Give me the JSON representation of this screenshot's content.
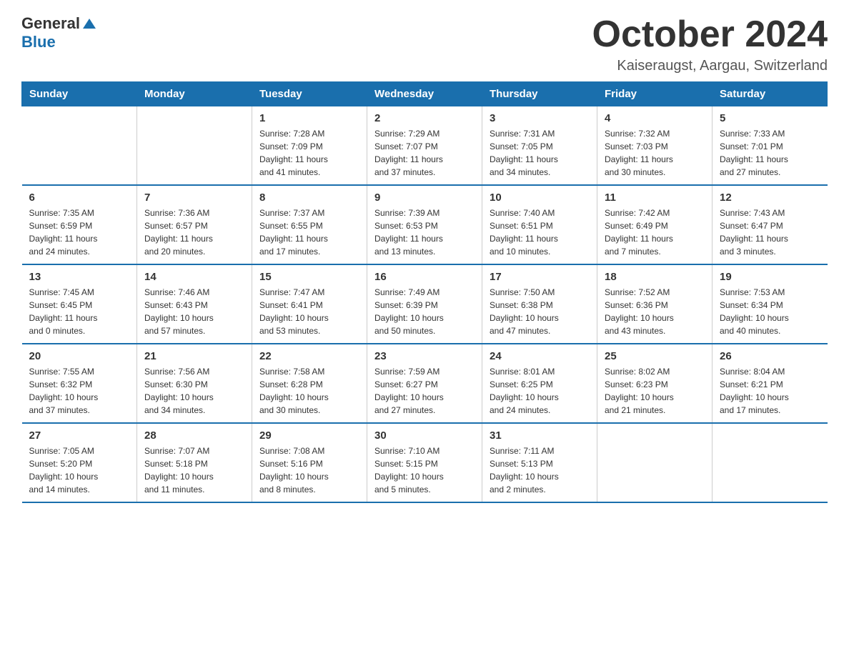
{
  "header": {
    "logo_general": "General",
    "logo_blue": "Blue",
    "title": "October 2024",
    "location": "Kaiseraugst, Aargau, Switzerland"
  },
  "columns": [
    "Sunday",
    "Monday",
    "Tuesday",
    "Wednesday",
    "Thursday",
    "Friday",
    "Saturday"
  ],
  "weeks": [
    [
      {
        "day": "",
        "info": ""
      },
      {
        "day": "",
        "info": ""
      },
      {
        "day": "1",
        "info": "Sunrise: 7:28 AM\nSunset: 7:09 PM\nDaylight: 11 hours\nand 41 minutes."
      },
      {
        "day": "2",
        "info": "Sunrise: 7:29 AM\nSunset: 7:07 PM\nDaylight: 11 hours\nand 37 minutes."
      },
      {
        "day": "3",
        "info": "Sunrise: 7:31 AM\nSunset: 7:05 PM\nDaylight: 11 hours\nand 34 minutes."
      },
      {
        "day": "4",
        "info": "Sunrise: 7:32 AM\nSunset: 7:03 PM\nDaylight: 11 hours\nand 30 minutes."
      },
      {
        "day": "5",
        "info": "Sunrise: 7:33 AM\nSunset: 7:01 PM\nDaylight: 11 hours\nand 27 minutes."
      }
    ],
    [
      {
        "day": "6",
        "info": "Sunrise: 7:35 AM\nSunset: 6:59 PM\nDaylight: 11 hours\nand 24 minutes."
      },
      {
        "day": "7",
        "info": "Sunrise: 7:36 AM\nSunset: 6:57 PM\nDaylight: 11 hours\nand 20 minutes."
      },
      {
        "day": "8",
        "info": "Sunrise: 7:37 AM\nSunset: 6:55 PM\nDaylight: 11 hours\nand 17 minutes."
      },
      {
        "day": "9",
        "info": "Sunrise: 7:39 AM\nSunset: 6:53 PM\nDaylight: 11 hours\nand 13 minutes."
      },
      {
        "day": "10",
        "info": "Sunrise: 7:40 AM\nSunset: 6:51 PM\nDaylight: 11 hours\nand 10 minutes."
      },
      {
        "day": "11",
        "info": "Sunrise: 7:42 AM\nSunset: 6:49 PM\nDaylight: 11 hours\nand 7 minutes."
      },
      {
        "day": "12",
        "info": "Sunrise: 7:43 AM\nSunset: 6:47 PM\nDaylight: 11 hours\nand 3 minutes."
      }
    ],
    [
      {
        "day": "13",
        "info": "Sunrise: 7:45 AM\nSunset: 6:45 PM\nDaylight: 11 hours\nand 0 minutes."
      },
      {
        "day": "14",
        "info": "Sunrise: 7:46 AM\nSunset: 6:43 PM\nDaylight: 10 hours\nand 57 minutes."
      },
      {
        "day": "15",
        "info": "Sunrise: 7:47 AM\nSunset: 6:41 PM\nDaylight: 10 hours\nand 53 minutes."
      },
      {
        "day": "16",
        "info": "Sunrise: 7:49 AM\nSunset: 6:39 PM\nDaylight: 10 hours\nand 50 minutes."
      },
      {
        "day": "17",
        "info": "Sunrise: 7:50 AM\nSunset: 6:38 PM\nDaylight: 10 hours\nand 47 minutes."
      },
      {
        "day": "18",
        "info": "Sunrise: 7:52 AM\nSunset: 6:36 PM\nDaylight: 10 hours\nand 43 minutes."
      },
      {
        "day": "19",
        "info": "Sunrise: 7:53 AM\nSunset: 6:34 PM\nDaylight: 10 hours\nand 40 minutes."
      }
    ],
    [
      {
        "day": "20",
        "info": "Sunrise: 7:55 AM\nSunset: 6:32 PM\nDaylight: 10 hours\nand 37 minutes."
      },
      {
        "day": "21",
        "info": "Sunrise: 7:56 AM\nSunset: 6:30 PM\nDaylight: 10 hours\nand 34 minutes."
      },
      {
        "day": "22",
        "info": "Sunrise: 7:58 AM\nSunset: 6:28 PM\nDaylight: 10 hours\nand 30 minutes."
      },
      {
        "day": "23",
        "info": "Sunrise: 7:59 AM\nSunset: 6:27 PM\nDaylight: 10 hours\nand 27 minutes."
      },
      {
        "day": "24",
        "info": "Sunrise: 8:01 AM\nSunset: 6:25 PM\nDaylight: 10 hours\nand 24 minutes."
      },
      {
        "day": "25",
        "info": "Sunrise: 8:02 AM\nSunset: 6:23 PM\nDaylight: 10 hours\nand 21 minutes."
      },
      {
        "day": "26",
        "info": "Sunrise: 8:04 AM\nSunset: 6:21 PM\nDaylight: 10 hours\nand 17 minutes."
      }
    ],
    [
      {
        "day": "27",
        "info": "Sunrise: 7:05 AM\nSunset: 5:20 PM\nDaylight: 10 hours\nand 14 minutes."
      },
      {
        "day": "28",
        "info": "Sunrise: 7:07 AM\nSunset: 5:18 PM\nDaylight: 10 hours\nand 11 minutes."
      },
      {
        "day": "29",
        "info": "Sunrise: 7:08 AM\nSunset: 5:16 PM\nDaylight: 10 hours\nand 8 minutes."
      },
      {
        "day": "30",
        "info": "Sunrise: 7:10 AM\nSunset: 5:15 PM\nDaylight: 10 hours\nand 5 minutes."
      },
      {
        "day": "31",
        "info": "Sunrise: 7:11 AM\nSunset: 5:13 PM\nDaylight: 10 hours\nand 2 minutes."
      },
      {
        "day": "",
        "info": ""
      },
      {
        "day": "",
        "info": ""
      }
    ]
  ]
}
